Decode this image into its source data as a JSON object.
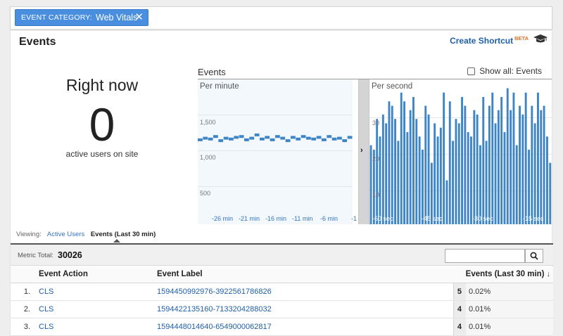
{
  "filter": {
    "key": "EVENT CATEGORY:",
    "value": "Web Vitals",
    "close": "✕"
  },
  "page": {
    "title": "Events",
    "shortcut": "Create Shortcut",
    "beta": "BETA"
  },
  "right_now": {
    "title": "Right now",
    "count": "0",
    "subtitle": "active users on site"
  },
  "charts": {
    "section_label": "Events",
    "show_all_label": "Show all: Events",
    "per_minute": {
      "title": "Per minute",
      "yticks": [
        "1,500",
        "1,000",
        "500"
      ],
      "xticks": [
        "-26 min",
        "-21 min",
        "-16 min",
        "-11 min",
        "-6 min",
        "-1"
      ]
    },
    "per_second": {
      "title": "Per second",
      "yticks": [
        "30",
        "20",
        "10"
      ],
      "xticks": [
        "-60 sec",
        "-45 sec",
        "-30 sec",
        "-15 sec"
      ]
    },
    "series_color": "#3d85c6"
  },
  "chart_data": [
    {
      "type": "line",
      "title": "Per minute",
      "ylim": [
        0,
        1750
      ],
      "x": [
        -30,
        -29,
        -28,
        -27,
        -26,
        -25,
        -24,
        -23,
        -22,
        -21,
        -20,
        -19,
        -18,
        -17,
        -16,
        -15,
        -14,
        -13,
        -12,
        -11,
        -10,
        -9,
        -8,
        -7,
        -6,
        -5,
        -4,
        -3,
        -2,
        -1
      ],
      "values": [
        1020,
        1040,
        1030,
        1060,
        1010,
        1040,
        1030,
        1050,
        1060,
        1020,
        1040,
        1080,
        1030,
        1050,
        1020,
        1060,
        1040,
        1010,
        1050,
        1030,
        1060,
        1040,
        1030,
        1050,
        1020,
        1060,
        1030,
        1040,
        1010,
        1050
      ]
    },
    {
      "type": "bar",
      "title": "Per second",
      "ylim": [
        0,
        33
      ],
      "x_range": [
        -60,
        -1
      ],
      "values": [
        18,
        17,
        24,
        20,
        25,
        23,
        28,
        27,
        24,
        19,
        30,
        28,
        21,
        26,
        29,
        24,
        20,
        17,
        27,
        25,
        14,
        23,
        20,
        22,
        30,
        10,
        28,
        19,
        24,
        23,
        29,
        27,
        21,
        20,
        26,
        25,
        18,
        29,
        19,
        27,
        30,
        23,
        26,
        29,
        21,
        31,
        26,
        30,
        18,
        27,
        25,
        30,
        17,
        27,
        23,
        30,
        26,
        27,
        20,
        14
      ]
    }
  ],
  "viewing": {
    "label": "Viewing:",
    "option_1": "Active Users",
    "option_2": "Events (Last 30 min)"
  },
  "metric": {
    "label": "Metric Total:",
    "value": "30026",
    "search_placeholder": ""
  },
  "table": {
    "headers": {
      "action": "Event Action",
      "label": "Event Label",
      "events": "Events (Last 30 min)"
    },
    "rows": [
      {
        "num": "1.",
        "action": "CLS",
        "label": "1594450992976-3922561786826",
        "count": "5",
        "pct": "0.02%"
      },
      {
        "num": "2.",
        "action": "CLS",
        "label": "1594422135160-7133204288032",
        "count": "4",
        "pct": "0.01%"
      },
      {
        "num": "3.",
        "action": "CLS",
        "label": "1594448014640-6549000062817",
        "count": "4",
        "pct": "0.01%"
      }
    ]
  }
}
